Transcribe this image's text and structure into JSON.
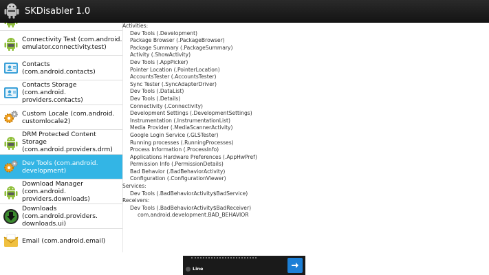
{
  "app": {
    "title": "SKDisabler 1.0",
    "icon": "android-bugdroid-icon"
  },
  "list": {
    "items": [
      {
        "label": "",
        "icon": "android-icon",
        "partial": true
      },
      {
        "label": "Connectivity Test (com.android.\nemulator.connectivity.test)",
        "icon": "android-icon"
      },
      {
        "label": "Contacts (com.android.contacts)",
        "icon": "contacts-icon"
      },
      {
        "label": "Contacts Storage (com.android.\nproviders.contacts)",
        "icon": "contacts-icon"
      },
      {
        "label": "Custom Locale (com.android.\ncustomlocale2)",
        "icon": "gear-icon"
      },
      {
        "label": "DRM Protected Content Storage\n(com.android.providers.drm)",
        "icon": "android-icon"
      },
      {
        "label": "Dev Tools (com.android.\ndevelopment)",
        "icon": "gear-icon",
        "selected": true
      },
      {
        "label": "Download Manager (com.android.\nproviders.downloads)",
        "icon": "android-icon"
      },
      {
        "label": "Downloads (com.android.providers.\ndownloads.ui)",
        "icon": "download-icon"
      },
      {
        "label": "Email (com.android.email)",
        "icon": "email-icon"
      }
    ]
  },
  "details": {
    "activities_header": "Activities:",
    "activities": [
      "Dev Tools (.Development)",
      "Package Browser (.PackageBrowser)",
      "Package Summary (.PackageSummary)",
      "Activity (.ShowActivity)",
      "Dev Tools (.AppPicker)",
      "Pointer Location (.PointerLocation)",
      "AccountsTester (.AccountsTester)",
      "Sync Tester (.SyncAdapterDriver)",
      "Dev Tools (.DataList)",
      "Dev Tools (.Details)",
      "Connectivity (.Connectivity)",
      "Development Settings (.DevelopmentSettings)",
      "Instrumentation (.InstrumentationList)",
      "Media Provider (.MediaScannerActivity)",
      "Google Login Service (.GLSTester)",
      "Running processes (.RunningProcesses)",
      "Process Information (.ProcessInfo)",
      "Applications Hardware Preferences (.AppHwPref)",
      "Permission Info (.PermissionDetails)",
      "Bad Behavior (.BadBehaviorActivity)",
      "Configuration (.ConfigurationViewer)"
    ],
    "services_header": "Services:",
    "services": [
      "Dev Tools (.BadBehaviorActivity$BadService)"
    ],
    "receivers_header": "Receivers:",
    "receivers": [
      "Dev Tools (.BadBehaviorActivity$BadReceiver)"
    ],
    "receiver_actions": [
      "com.android.development.BAD_BEHAVIOR"
    ]
  },
  "ad": {
    "text": "Line",
    "button_icon": "arrow-right-icon",
    "button_color": "#1c7fd6"
  },
  "colors": {
    "selected": "#33b5e5",
    "actionbar": "#1e1e1e"
  }
}
